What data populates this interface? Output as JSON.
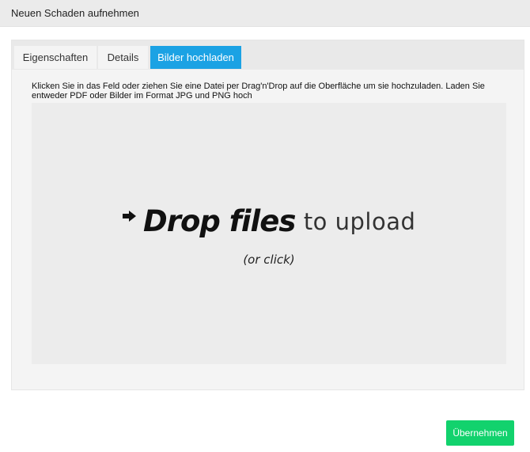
{
  "dialog": {
    "title": "Neuen Schaden aufnehmen"
  },
  "tabs": [
    {
      "label": "Eigenschaften",
      "active": false
    },
    {
      "label": "Details",
      "active": false
    },
    {
      "label": "Bilder hochladen",
      "active": true
    }
  ],
  "upload": {
    "instructions": "Klicken Sie in das Feld oder ziehen Sie eine Datei per Drag'n'Drop auf die Oberfläche um sie hochzuladen. Laden Sie entweder PDF oder Bilder im Format JPG und PNG hoch",
    "drop_bold": "Drop files",
    "drop_light": "to upload",
    "drop_sub": "(or click)",
    "icon": "arrow-right-icon"
  },
  "footer": {
    "submit_label": "Übernehmen"
  },
  "colors": {
    "active_tab": "#1ba2e4",
    "submit": "#12d26d"
  }
}
